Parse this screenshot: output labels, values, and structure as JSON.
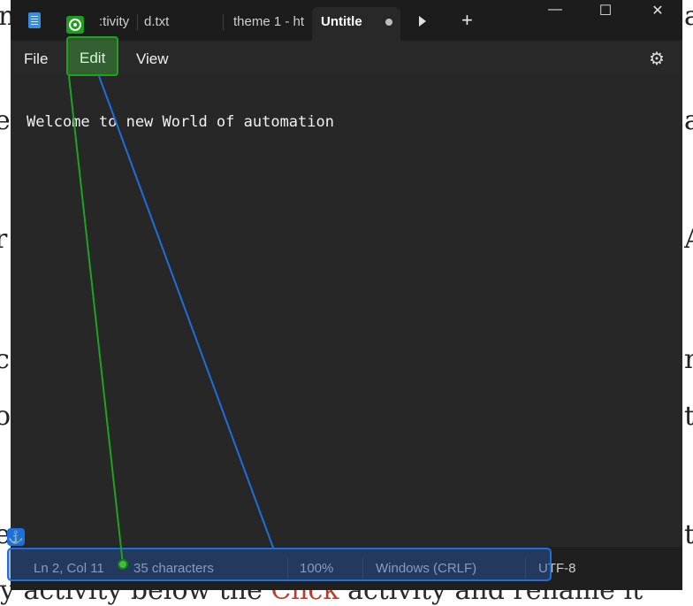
{
  "background": {
    "left_fragments": [
      "n",
      "e",
      "r",
      "c",
      "o",
      "e"
    ],
    "right_fragments": [
      "a",
      "a",
      "A",
      "n",
      "t",
      "t"
    ],
    "bottom_text_plain": "y activity below the ",
    "bottom_text_red": "Click",
    "bottom_text_tail": " activity and rename it"
  },
  "tabs": [
    {
      "label": ":tivity",
      "active": false
    },
    {
      "label": "d.txt",
      "active": false
    },
    {
      "label": "theme 1 - ht",
      "active": false
    },
    {
      "label": "Untitle",
      "active": true
    }
  ],
  "window_controls": {
    "minimize": "—",
    "maximize": "☐",
    "close": "✕"
  },
  "new_tab_label": "+",
  "menu": {
    "file": "File",
    "edit": "Edit",
    "view": "View"
  },
  "icons": {
    "settings": "gear-icon",
    "anchor": "anchor-icon",
    "target": "target-icon"
  },
  "editor": {
    "content": "Welcome to new World of automation"
  },
  "status": {
    "position": "Ln 2, Col 11",
    "characters": "35 characters",
    "zoom": "100%",
    "line_ending": "Windows (CRLF)",
    "encoding": "UTF-8"
  },
  "colors": {
    "window_bg": "#202020",
    "highlight_green": "#1fa31f",
    "highlight_blue": "#1e6fdc"
  }
}
